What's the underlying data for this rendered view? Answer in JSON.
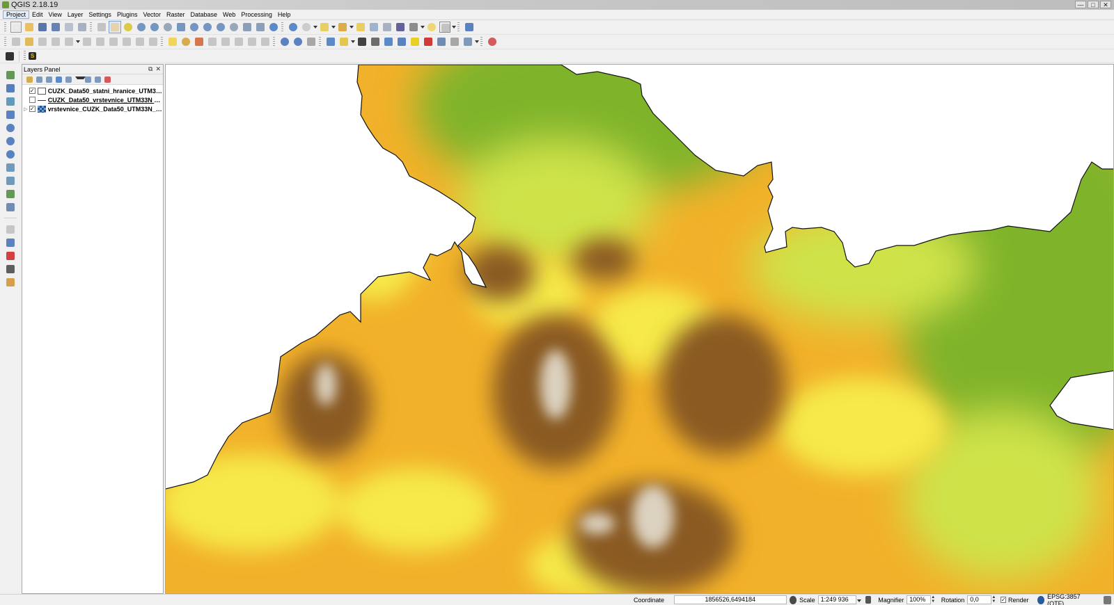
{
  "window": {
    "title": "QGIS 2.18.19",
    "minimize": "—",
    "maximize": "□",
    "close": "✕"
  },
  "menu": [
    "Project",
    "Edit",
    "View",
    "Layer",
    "Settings",
    "Plugins",
    "Vector",
    "Raster",
    "Database",
    "Web",
    "Processing",
    "Help"
  ],
  "layers_panel": {
    "title": "Layers Panel",
    "float_glyph": "⧉",
    "close_glyph": "✕",
    "layers": [
      {
        "name": "CUZK_Data50_statni_hranice_UTM33...",
        "checked": true,
        "symbol": "polygon",
        "expandable": false
      },
      {
        "name": "CUZK_Data50_vrstevnice_UTM33N vr...",
        "checked": false,
        "symbol": "line",
        "expandable": false
      },
      {
        "name": "vrstevnice_CUZK_Data50_UTM33N_E...",
        "checked": true,
        "symbol": "raster",
        "expandable": true
      }
    ]
  },
  "toolbar3": {
    "plugin_label": "S"
  },
  "status": {
    "coordinate_label": "Coordinate",
    "coordinate_value": "1856526,6494184",
    "scale_label": "Scale",
    "scale_value": "1:249 936",
    "magnifier_label": "Magnifier",
    "magnifier_value": "100%",
    "rotation_label": "Rotation",
    "rotation_value": "0,0",
    "render_label": "Render",
    "crs": "EPSG:3857 (OTF)"
  },
  "colors": {
    "low": "#7fb42a",
    "mid_low": "#cfe34a",
    "mid": "#f6e94a",
    "mid_high": "#f2b12a",
    "high": "#8a5a20",
    "peak": "#dcd2c0"
  }
}
